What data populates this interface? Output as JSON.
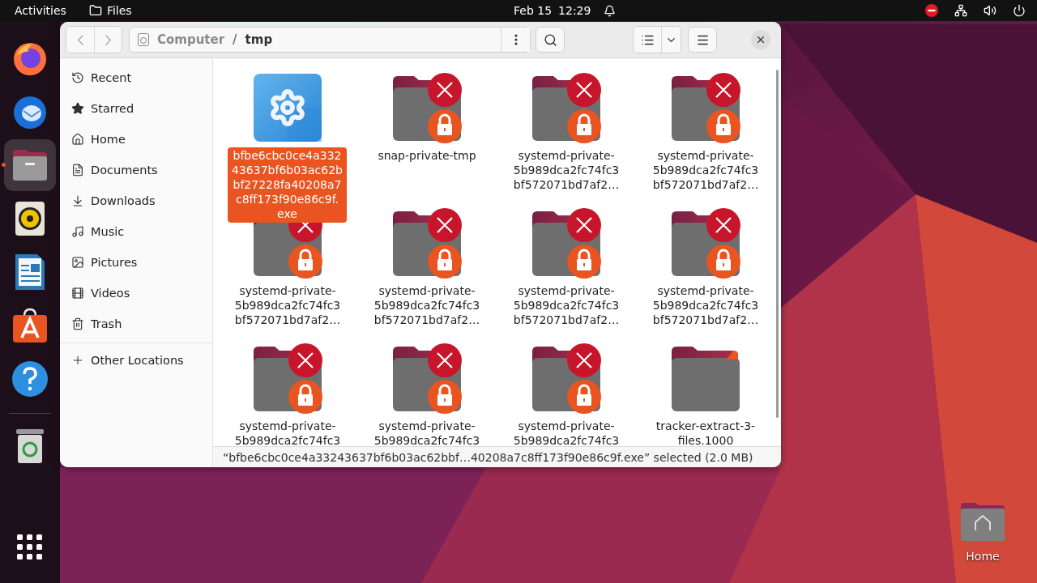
{
  "top_bar": {
    "activities": "Activities",
    "app_name": "Files",
    "date": "Feb 15",
    "time": "12:29"
  },
  "dock": [
    {
      "kind": "firefox",
      "selected": false
    },
    {
      "kind": "thunderbird",
      "selected": false
    },
    {
      "kind": "files",
      "selected": true
    },
    {
      "kind": "rhythmbox",
      "selected": false
    },
    {
      "kind": "writer",
      "selected": false
    },
    {
      "kind": "software",
      "selected": false
    },
    {
      "kind": "help",
      "selected": false
    },
    {
      "kind": "trash",
      "selected": false
    },
    {
      "kind": "apps",
      "selected": false
    }
  ],
  "window": {
    "path": [
      {
        "label": "Computer",
        "selected": false
      },
      {
        "label": "tmp",
        "selected": true
      }
    ],
    "path_separator": "/",
    "sidebar": [
      {
        "label": "Recent",
        "kind": "recent"
      },
      {
        "label": "Starred",
        "kind": "starred"
      },
      {
        "label": "Home",
        "kind": "home"
      },
      {
        "label": "Documents",
        "kind": "documents"
      },
      {
        "label": "Downloads",
        "kind": "downloads"
      },
      {
        "label": "Music",
        "kind": "music"
      },
      {
        "label": "Pictures",
        "kind": "pictures"
      },
      {
        "label": "Videos",
        "kind": "videos"
      },
      {
        "label": "Trash",
        "kind": "trash"
      }
    ],
    "other_locations": "Other Locations",
    "files": [
      {
        "kind": "executable",
        "selected": true,
        "lines": [
          "bfbe6cbc0ce4a332",
          "43637bf6b03ac62b",
          "bf27228fa40208a7",
          "c8ff173f90e86c9f.",
          "exe"
        ]
      },
      {
        "kind": "locked",
        "selected": false,
        "lines": [
          "snap-private-tmp"
        ]
      },
      {
        "kind": "locked",
        "selected": false,
        "lines": [
          "systemd-private-",
          "5b989dca2fc74fc3",
          "bf572071bd7af2…"
        ]
      },
      {
        "kind": "locked",
        "selected": false,
        "lines": [
          "systemd-private-",
          "5b989dca2fc74fc3",
          "bf572071bd7af2…"
        ]
      },
      {
        "kind": "locked",
        "selected": false,
        "lines": [
          "systemd-private-",
          "5b989dca2fc74fc3",
          "bf572071bd7af2…"
        ]
      },
      {
        "kind": "locked",
        "selected": false,
        "lines": [
          "systemd-private-",
          "5b989dca2fc74fc3",
          "bf572071bd7af2…"
        ]
      },
      {
        "kind": "locked",
        "selected": false,
        "lines": [
          "systemd-private-",
          "5b989dca2fc74fc3",
          "bf572071bd7af2…"
        ]
      },
      {
        "kind": "locked",
        "selected": false,
        "lines": [
          "systemd-private-",
          "5b989dca2fc74fc3",
          "bf572071bd7af2…"
        ]
      },
      {
        "kind": "locked",
        "selected": false,
        "lines": [
          "systemd-private-",
          "5b989dca2fc74fc3"
        ]
      },
      {
        "kind": "locked",
        "selected": false,
        "lines": [
          "systemd-private-",
          "5b989dca2fc74fc3"
        ]
      },
      {
        "kind": "locked",
        "selected": false,
        "lines": [
          "systemd-private-",
          "5b989dca2fc74fc3"
        ]
      },
      {
        "kind": "folder",
        "selected": false,
        "lines": [
          "tracker-extract-3-",
          "files.1000"
        ]
      }
    ],
    "status": "“bfbe6cbc0ce4a33243637bf6b03ac62bbf…40208a7c8ff173f90e86c9f.exe” selected (2.0 MB)"
  },
  "desktop_icons": [
    {
      "label": "Home"
    }
  ]
}
